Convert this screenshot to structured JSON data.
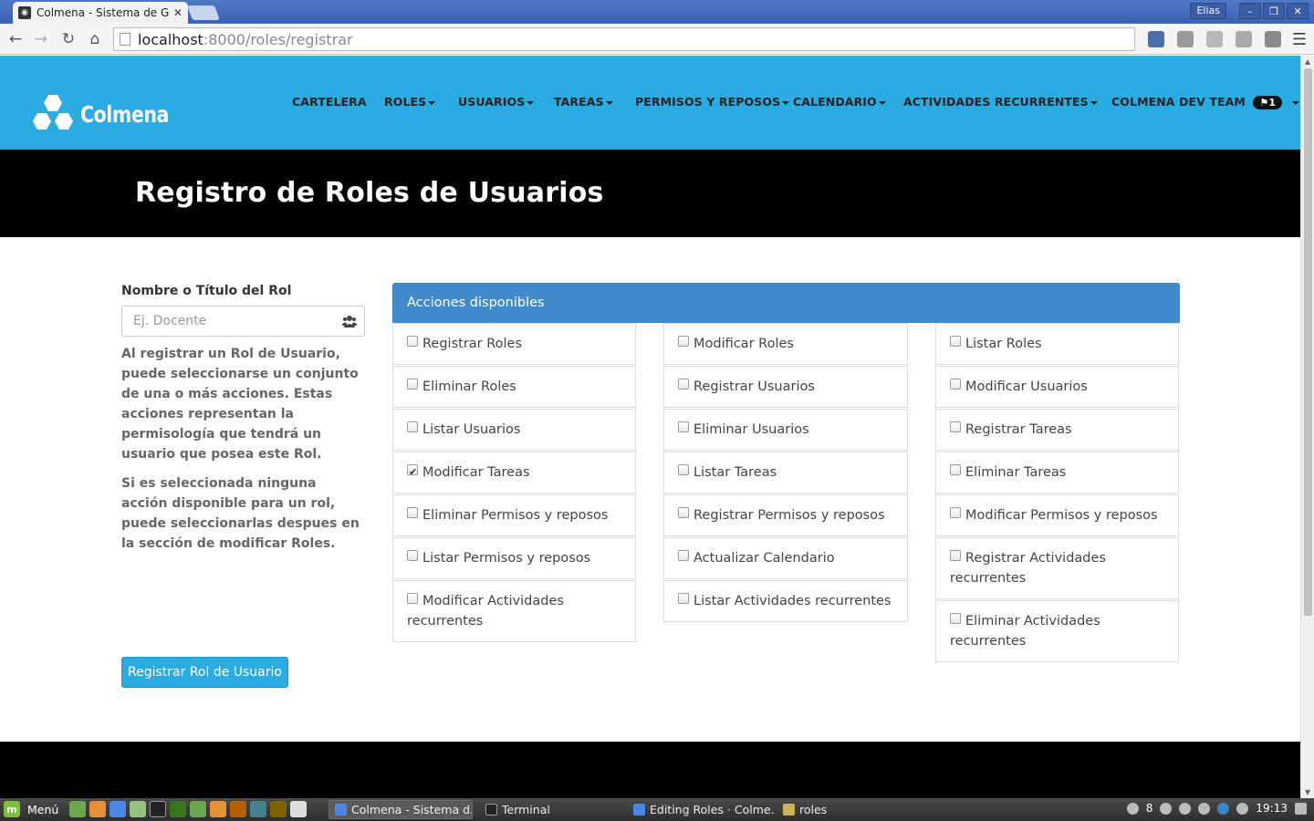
{
  "browser": {
    "tab_title": "Colmena - Sistema de Ge",
    "url_host": "localhost",
    "url_rest": ":8000/roles/registrar",
    "window_user": "Elias"
  },
  "navbar": {
    "brand": "Colmena",
    "items": [
      {
        "label": "CARTELERA",
        "dropdown": false
      },
      {
        "label": "ROLES",
        "dropdown": true
      },
      {
        "label": "USUARIOS",
        "dropdown": true
      },
      {
        "label": "TAREAS",
        "dropdown": true
      },
      {
        "label": "PERMISOS Y REPOSOS",
        "dropdown": true
      },
      {
        "label": "CALENDARIO",
        "dropdown": true
      },
      {
        "label": "ACTIVIDADES RECURRENTES",
        "dropdown": true
      }
    ],
    "team": "COLMENA DEV TEAM",
    "notifications": "1",
    "color": "#2aabe2"
  },
  "page": {
    "title": "Registro de Roles de Usuarios"
  },
  "form": {
    "name_label": "Nombre o Título del Rol",
    "name_placeholder": "Ej. Docente",
    "name_value": "",
    "help_1": "Al registrar un Rol de Usuario, puede seleccionarse un conjunto de una o más acciones. Estas acciones representan la permisología que tendrá un usuario que posea este Rol.",
    "help_2": "Si es seleccionada ninguna acción disponible para un rol, puede seleccionarlas despues en la sección de modificar Roles.",
    "submit_label": "Registrar Rol de Usuario"
  },
  "actions": {
    "heading": "Acciones disponibles",
    "heading_color": "#428bca",
    "columns": [
      [
        {
          "label": "Registrar Roles",
          "checked": false
        },
        {
          "label": "Eliminar Roles",
          "checked": false
        },
        {
          "label": "Listar Usuarios",
          "checked": false
        },
        {
          "label": "Modificar Tareas",
          "checked": true
        },
        {
          "label": "Eliminar Permisos y reposos",
          "checked": false
        },
        {
          "label": "Listar Permisos y reposos",
          "checked": false
        },
        {
          "label": "Modificar Actividades recurrentes",
          "checked": false
        }
      ],
      [
        {
          "label": "Modificar Roles",
          "checked": false
        },
        {
          "label": "Registrar Usuarios",
          "checked": false
        },
        {
          "label": "Eliminar Usuarios",
          "checked": false
        },
        {
          "label": "Listar Tareas",
          "checked": false
        },
        {
          "label": "Registrar Permisos y reposos",
          "checked": false
        },
        {
          "label": "Actualizar Calendario",
          "checked": false
        },
        {
          "label": "Listar Actividades recurrentes",
          "checked": false
        }
      ],
      [
        {
          "label": "Listar Roles",
          "checked": false
        },
        {
          "label": "Modificar Usuarios",
          "checked": false
        },
        {
          "label": "Registrar Tareas",
          "checked": false
        },
        {
          "label": "Eliminar Tareas",
          "checked": false
        },
        {
          "label": "Modificar Permisos y reposos",
          "checked": false
        },
        {
          "label": "Registrar Actividades recurrentes",
          "checked": false
        },
        {
          "label": "Eliminar Actividades recurrentes",
          "checked": false
        }
      ]
    ]
  },
  "taskbar": {
    "menu_label": "Menú",
    "tasks": [
      {
        "label": "Colmena - Sistema d...",
        "active": true
      },
      {
        "label": "Terminal",
        "active": false
      },
      {
        "label": "Editing Roles · Colme...",
        "active": false
      },
      {
        "label": "roles",
        "active": false
      }
    ],
    "tray_count": "8",
    "clock": "19:13"
  }
}
